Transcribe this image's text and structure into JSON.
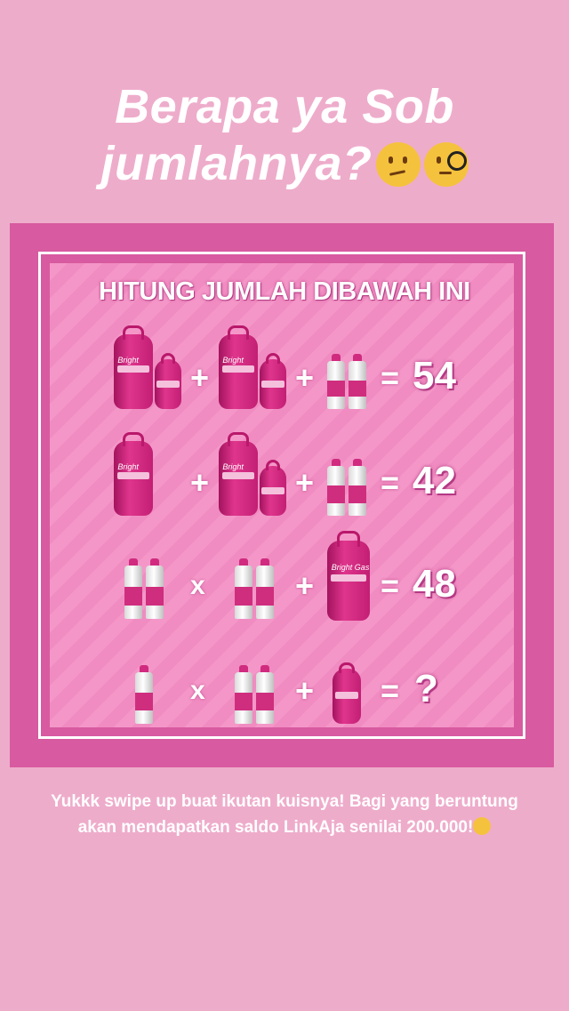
{
  "headline": {
    "line1": "Berapa ya Sob",
    "line2": "jumlahnya?"
  },
  "puzzle": {
    "title": "HITUNG JUMLAH DIBAWAH INI",
    "rows": [
      {
        "op1": "+",
        "op2": "+",
        "eq": "=",
        "result": "54"
      },
      {
        "op1": "+",
        "op2": "+",
        "eq": "=",
        "result": "42"
      },
      {
        "op1": "x",
        "op2": "+",
        "eq": "=",
        "result": "48"
      },
      {
        "op1": "x",
        "op2": "+",
        "eq": "=",
        "result": "?"
      }
    ],
    "brand": "Bright Gas"
  },
  "footer": {
    "line1": "Yukkk swipe up buat ikutan kuisnya! Bagi yang beruntung",
    "line2": "akan mendapatkan saldo LinkAja senilai 200.000!"
  },
  "colors": {
    "background": "#eeaccb",
    "panel": "#d85aa0",
    "tank": "#d0267d"
  },
  "icons": [
    "thinking-face-icon",
    "monocle-face-icon",
    "grinning-squinting-face-icon",
    "gas-cylinder-icon",
    "gas-canister-icon"
  ]
}
